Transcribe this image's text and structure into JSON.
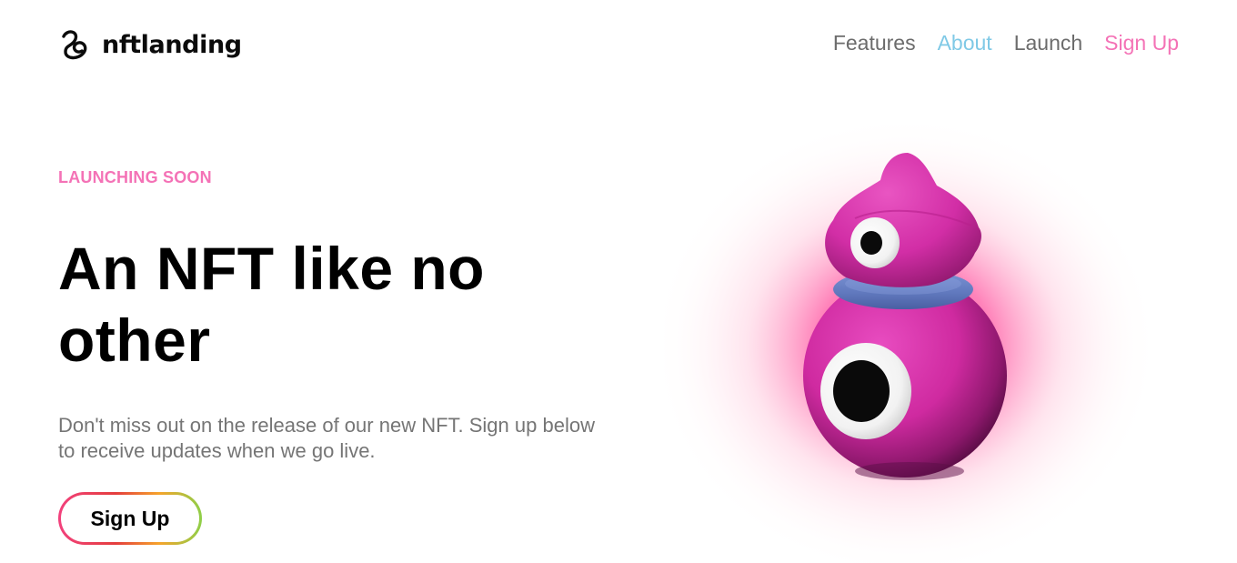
{
  "brand": {
    "name": "nftlanding",
    "icon": "spiral-logo-icon"
  },
  "nav": {
    "items": [
      {
        "label": "Features"
      },
      {
        "label": "About"
      },
      {
        "label": "Launch"
      },
      {
        "label": "Sign Up"
      }
    ],
    "active": "About"
  },
  "hero": {
    "eyebrow": "LAUNCHING SOON",
    "headline_line1": "An NFT like no",
    "headline_line2": "other",
    "description": "Don't miss out on the release of our new NFT. Sign up below to receive updates when we go live.",
    "cta_label": "Sign Up",
    "image": "pink-one-eyed-creature-illustration"
  },
  "colors": {
    "accent_pink": "#f472b6",
    "accent_blue": "#7fc9e6",
    "text_muted": "#757575",
    "creature_pink": "#d52fa6",
    "collar_blue": "#6b82c4"
  }
}
